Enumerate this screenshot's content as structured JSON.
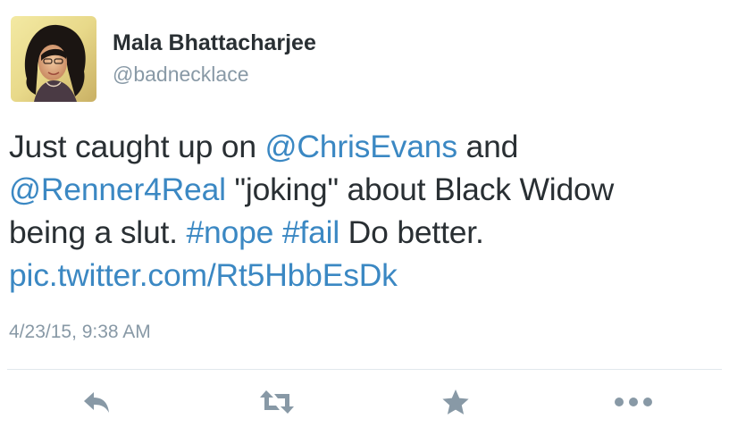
{
  "author": {
    "display_name": "Mala Bhattacharjee",
    "handle": "@badnecklace",
    "avatar_icon": "profile-photo"
  },
  "tweet": {
    "lines": [
      [
        {
          "text": "Just caught up on ",
          "kind": "text"
        },
        {
          "text": "@ChrisEvans",
          "kind": "mention"
        },
        {
          "text": " and",
          "kind": "text"
        }
      ],
      [
        {
          "text": "@Renner4Real",
          "kind": "mention"
        },
        {
          "text": " \"joking\" about Black Widow",
          "kind": "text"
        }
      ],
      [
        {
          "text": "being a slut. ",
          "kind": "text"
        },
        {
          "text": "#nope",
          "kind": "hashtag"
        },
        {
          "text": " ",
          "kind": "text"
        },
        {
          "text": "#fail",
          "kind": "hashtag"
        },
        {
          "text": " Do better.",
          "kind": "text"
        }
      ],
      [
        {
          "text": "pic.twitter.com/Rt5HbbEsDk",
          "kind": "link"
        }
      ]
    ],
    "timestamp": "4/23/15, 9:38 AM"
  },
  "actions": {
    "reply_icon": "reply-icon",
    "retweet_icon": "retweet-icon",
    "favorite_icon": "star-icon",
    "more_icon": "more-icon"
  },
  "colors": {
    "text": "#292f33",
    "link": "#3b88c3",
    "muted": "#8899a6",
    "divider": "#e1e8ed"
  }
}
